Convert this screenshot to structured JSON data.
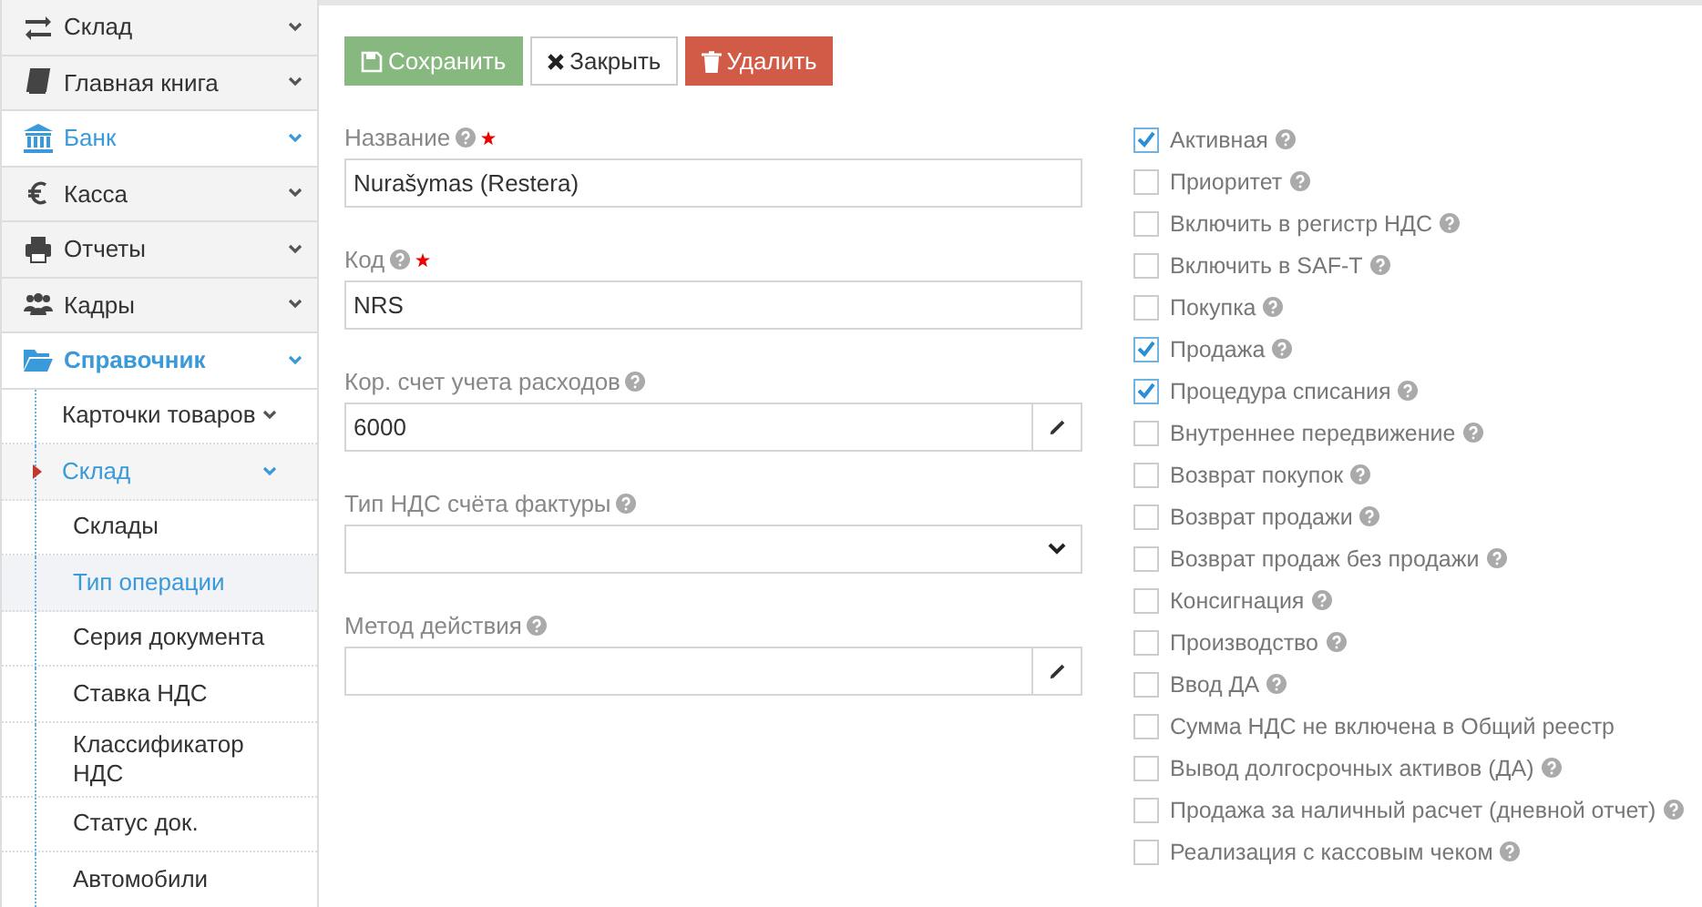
{
  "sidebar": {
    "items": [
      {
        "label": "Склад",
        "highlighted": false,
        "expanded": false
      },
      {
        "label": "Главная книга",
        "highlighted": false,
        "expanded": false
      },
      {
        "label": "Банк",
        "highlighted": true,
        "expanded": false
      },
      {
        "label": "Касса",
        "highlighted": false,
        "expanded": false
      },
      {
        "label": "Отчеты",
        "highlighted": false,
        "expanded": false
      },
      {
        "label": "Кадры",
        "highlighted": false,
        "expanded": false
      },
      {
        "label": "Справочник",
        "highlighted": true,
        "expanded": true,
        "children": [
          {
            "label": "Карточки товаров",
            "expanded": false
          },
          {
            "label": "Склад",
            "expanded": true,
            "children": [
              {
                "label": "Склады",
                "selected": false
              },
              {
                "label": "Тип операции",
                "selected": true
              },
              {
                "label": "Серия документа",
                "selected": false
              },
              {
                "label": "Ставка НДС",
                "selected": false
              },
              {
                "label": "Классификатор НДС",
                "selected": false
              },
              {
                "label": "Статус док.",
                "selected": false
              },
              {
                "label": "Автомобили",
                "selected": false
              }
            ]
          }
        ]
      }
    ]
  },
  "toolbar": {
    "buttons": [
      {
        "label": "Сохранить",
        "kind": "save"
      },
      {
        "label": "Закрыть",
        "kind": "close"
      },
      {
        "label": "Удалить",
        "kind": "delete"
      }
    ]
  },
  "form": {
    "fields": [
      {
        "label": "Название",
        "required": true,
        "kind": "text",
        "value": "Nurašymas (Restera)"
      },
      {
        "label": "Код",
        "required": true,
        "kind": "text",
        "value": "NRS"
      },
      {
        "label": "Кор. счет учета расходов",
        "required": false,
        "kind": "lookup",
        "value": "6000"
      },
      {
        "label": "Тип НДС счёта фактуры",
        "required": false,
        "kind": "select"
      },
      {
        "label": "Метод действия",
        "required": false,
        "kind": "lookup"
      }
    ]
  },
  "options": [
    {
      "label": "Активная",
      "checked": true,
      "help": true
    },
    {
      "label": "Приоритет",
      "checked": false,
      "help": true
    },
    {
      "label": "Включить в регистр НДС",
      "checked": false,
      "help": true
    },
    {
      "label": "Включить в SAF-T",
      "checked": false,
      "help": true
    },
    {
      "label": "Покупка",
      "checked": false,
      "help": true
    },
    {
      "label": "Продажа",
      "checked": true,
      "help": true
    },
    {
      "label": "Процедура списания",
      "checked": true,
      "help": true
    },
    {
      "label": "Внутреннее передвижение",
      "checked": false,
      "help": true
    },
    {
      "label": "Возврат покупок",
      "checked": false,
      "help": true
    },
    {
      "label": "Возврат продажи",
      "checked": false,
      "help": true
    },
    {
      "label": "Возврат продаж без продажи",
      "checked": false,
      "help": true
    },
    {
      "label": "Консигнация",
      "checked": false,
      "help": true
    },
    {
      "label": "Производство",
      "checked": false,
      "help": true
    },
    {
      "label": "Ввод ДА",
      "checked": false,
      "help": true
    },
    {
      "label": "Сумма НДС не включена в Общий реестр",
      "checked": false,
      "help": false
    },
    {
      "label": "Вывод долгосрочных активов (ДА)",
      "checked": false,
      "help": true
    },
    {
      "label": "Продажа за наличный расчет (дневной отчет)",
      "checked": false,
      "help": true
    },
    {
      "label": "Реализация с кассовым чеком",
      "checked": false,
      "help": true
    }
  ]
}
